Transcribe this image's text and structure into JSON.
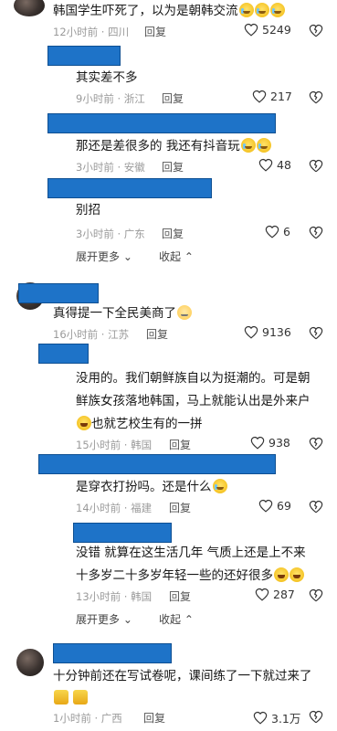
{
  "c1": {
    "text": "韩国学生吓死了，以为是朝韩交流",
    "time": "12小时前 · 四川",
    "reply": "回复",
    "likes": "5249"
  },
  "r1": {
    "text": "其实差不多",
    "time": "9小时前 · 浙江",
    "reply": "回复",
    "likes": "217"
  },
  "r2": {
    "text": "那还是差很多的 我还有抖音玩",
    "time": "3小时前 · 安徽",
    "reply": "回复",
    "likes": "48"
  },
  "r3": {
    "text": "别招",
    "time": "3小时前 · 广东",
    "reply": "回复",
    "likes": "6"
  },
  "more1": {
    "expand": "展开更多",
    "collapse": "收起"
  },
  "c2": {
    "text": "真得提一下全民美商了",
    "time": "16小时前 · 江苏",
    "reply": "回复",
    "likes": "9136"
  },
  "r4": {
    "line1": "没用的。我们朝鲜族自以为挺潮的。可是朝",
    "line2": "鲜族女孩落地韩国，马上就能认出是外来户",
    "line3": "也就艺校生有的一拼",
    "time": "15小时前 · 韩国",
    "reply": "回复",
    "likes": "938"
  },
  "r5": {
    "text": "是穿衣打扮吗。还是什么",
    "time": "14小时前 · 福建",
    "reply": "回复",
    "likes": "69"
  },
  "r6": {
    "line1": "没错 就算在这生活几年 气质上还是上不来",
    "line2": "十多岁二十多岁年轻一些的还好很多",
    "time": "13小时前 · 韩国",
    "reply": "回复",
    "likes": "287"
  },
  "more2": {
    "expand": "展开更多",
    "collapse": "收起"
  },
  "c3": {
    "line1": "十分钟前还在写试卷呢，课间练了一下就过来了",
    "time": "1小时前 · 广西",
    "reply": "回复",
    "likes": "3.1万"
  },
  "icons": {
    "heart": "heart-outline-icon",
    "dislike": "broken-heart-icon",
    "chevron_down": "chevron-down-icon",
    "chevron_up": "chevron-up-icon"
  }
}
